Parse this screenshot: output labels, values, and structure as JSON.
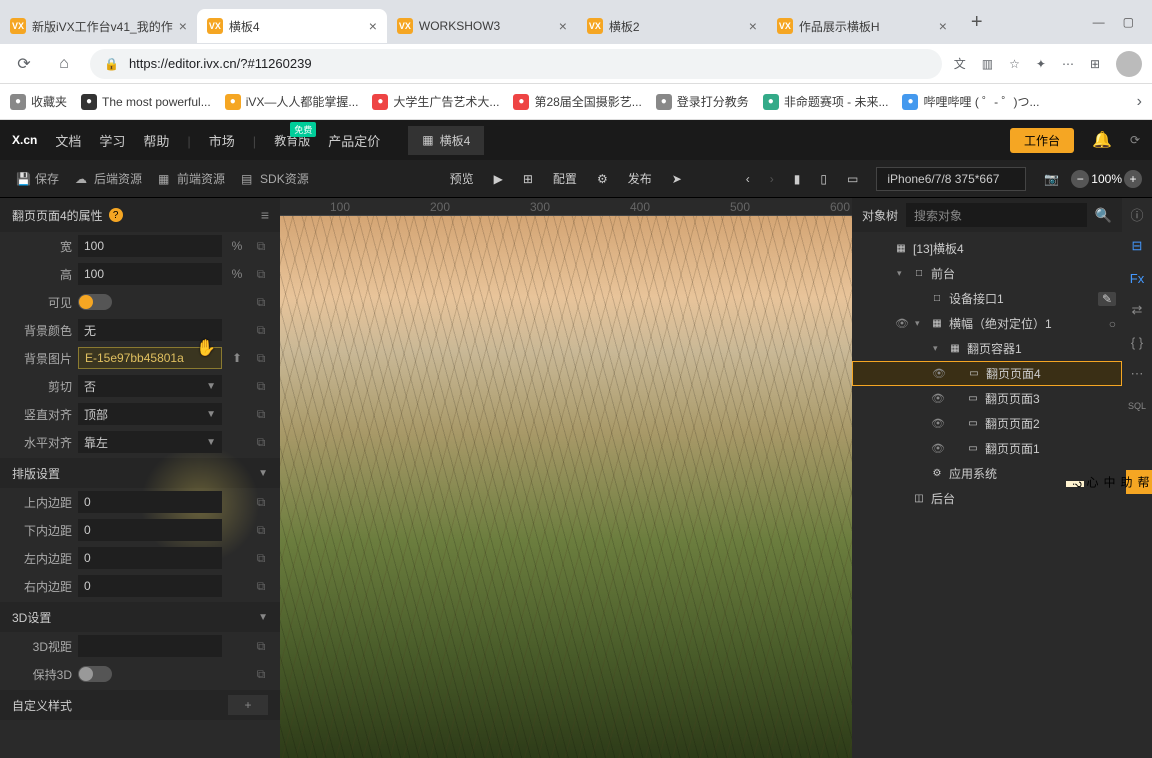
{
  "browser": {
    "tabs": [
      {
        "title": "新版iVX工作台v41_我的作",
        "icon": "VX",
        "active": false
      },
      {
        "title": "横板4",
        "icon": "VX",
        "active": true
      },
      {
        "title": "WORKSHOW3",
        "icon": "VX",
        "active": false
      },
      {
        "title": "横板2",
        "icon": "VX",
        "active": false
      },
      {
        "title": "作品展示横板H",
        "icon": "VX",
        "active": false
      }
    ],
    "url": "https://editor.ivx.cn/?#11260239",
    "bookmarks": [
      {
        "label": "收藏夹",
        "color": "#888"
      },
      {
        "label": "The most powerful...",
        "color": "#333"
      },
      {
        "label": "iVX—人人都能掌握...",
        "color": "#f5a623"
      },
      {
        "label": "大学生广告艺术大...",
        "color": "#e44"
      },
      {
        "label": "第28届全国摄影艺...",
        "color": "#e44"
      },
      {
        "label": "登录打分教务",
        "color": "#888"
      },
      {
        "label": "非命题赛项 - 未来...",
        "color": "#3a8"
      },
      {
        "label": "哔哩哔哩 ( ゜- ゜)つ...",
        "color": "#49e"
      }
    ]
  },
  "app": {
    "logo": "X.cn",
    "menu": [
      "文档",
      "学习",
      "帮助",
      "市场",
      "教育版",
      "产品定价"
    ],
    "edu_badge": "免费",
    "active_tab": "横板4",
    "workspace": "工作台",
    "toolbar": {
      "save": "保存",
      "backend": "后端资源",
      "frontend": "前端资源",
      "sdk": "SDK资源",
      "preview": "预览",
      "config": "配置",
      "publish": "发布",
      "device": "iPhone6/7/8 375*667",
      "zoom": "100%"
    }
  },
  "props": {
    "title": "翻页页面4的属性",
    "width": {
      "label": "宽",
      "value": "100",
      "unit": "%"
    },
    "height": {
      "label": "高",
      "value": "100",
      "unit": "%"
    },
    "visible": {
      "label": "可见",
      "value": true
    },
    "bgcolor": {
      "label": "背景颜色",
      "value": "无"
    },
    "bgimage": {
      "label": "背景图片",
      "value": "E-15e97bb45801a"
    },
    "clip": {
      "label": "剪切",
      "value": "否"
    },
    "valign": {
      "label": "竖直对齐",
      "value": "顶部"
    },
    "halign": {
      "label": "水平对齐",
      "value": "靠左"
    },
    "layout_section": "排版设置",
    "pad_top": {
      "label": "上内边距",
      "value": "0"
    },
    "pad_bottom": {
      "label": "下内边距",
      "value": "0"
    },
    "pad_left": {
      "label": "左内边距",
      "value": "0"
    },
    "pad_right": {
      "label": "右内边距",
      "value": "0"
    },
    "d3_section": "3D设置",
    "d3_perspective": {
      "label": "3D视距",
      "value": ""
    },
    "d3_keep": {
      "label": "保持3D",
      "value": false
    },
    "custom_section": "自定义样式"
  },
  "ruler": [
    "100",
    "200",
    "300",
    "400",
    "500",
    "600"
  ],
  "tree": {
    "title": "对象树",
    "search_placeholder": "搜索对象",
    "nodes": [
      {
        "indent": 0,
        "icon": "▦",
        "label": "[13]横板4",
        "eye": false,
        "exp": ""
      },
      {
        "indent": 1,
        "icon": "▾",
        "label": "前台",
        "eye": false,
        "exp": "▾",
        "pre": "□"
      },
      {
        "indent": 2,
        "icon": "",
        "label": "设备接口1",
        "eye": false,
        "exp": "",
        "pre": "□",
        "badge": true
      },
      {
        "indent": 2,
        "icon": "",
        "label": "横幅（绝对定位）1",
        "eye": true,
        "exp": "▾",
        "pre": "▦",
        "dot": true
      },
      {
        "indent": 3,
        "icon": "",
        "label": "翻页容器1",
        "eye": false,
        "exp": "▾",
        "pre": "▦"
      },
      {
        "indent": 4,
        "icon": "",
        "label": "翻页页面4",
        "eye": true,
        "exp": "",
        "pre": "▭",
        "sel": true
      },
      {
        "indent": 4,
        "icon": "",
        "label": "翻页页面3",
        "eye": true,
        "exp": "",
        "pre": "▭"
      },
      {
        "indent": 4,
        "icon": "",
        "label": "翻页页面2",
        "eye": true,
        "exp": "",
        "pre": "▭"
      },
      {
        "indent": 4,
        "icon": "",
        "label": "翻页页面1",
        "eye": true,
        "exp": "",
        "pre": "▭"
      },
      {
        "indent": 2,
        "icon": "",
        "label": "应用系统",
        "eye": false,
        "exp": "",
        "pre": "⚙"
      },
      {
        "indent": 1,
        "icon": "",
        "label": "后台",
        "eye": false,
        "exp": "",
        "pre": "◫"
      }
    ]
  },
  "help_float": "帮助中心 ?"
}
